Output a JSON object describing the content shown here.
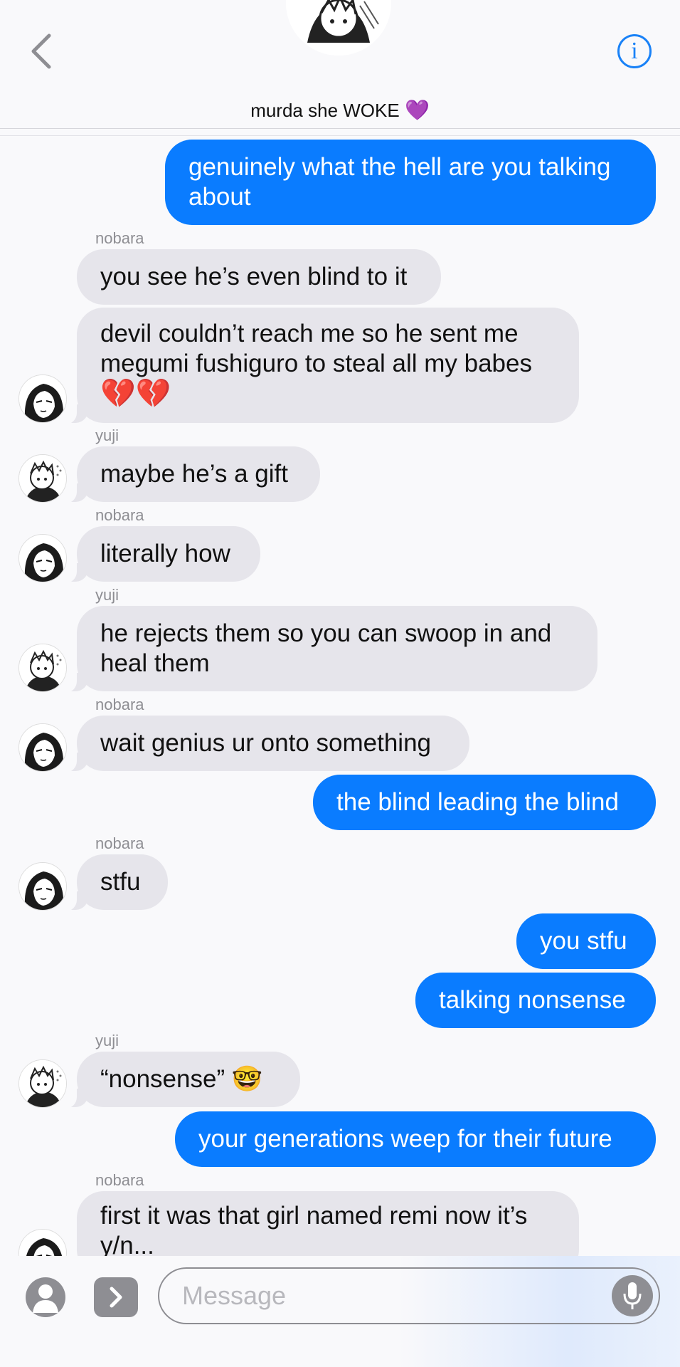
{
  "header": {
    "title": "murda she WOKE",
    "title_emoji": "💜",
    "info_label": "i"
  },
  "messages": [
    {
      "side": "out",
      "text": "genuinely what the hell are you talking\nabout"
    },
    {
      "side": "in",
      "sender": "nobara",
      "text": "you see he’s even blind to it"
    },
    {
      "side": "in",
      "text": "devil couldn’t reach me so he sent me\nmegumi fushiguro to steal all my babes",
      "emoji": "💔💔"
    },
    {
      "side": "in",
      "sender": "yuji",
      "text": "maybe he’s a gift"
    },
    {
      "side": "in",
      "sender": "nobara",
      "text": "literally how"
    },
    {
      "side": "in",
      "sender": "yuji",
      "text": "he rejects them so you can swoop in and\nheal them"
    },
    {
      "side": "in",
      "sender": "nobara",
      "text": "wait genius ur onto something"
    },
    {
      "side": "out",
      "text": "the blind leading the blind"
    },
    {
      "side": "in",
      "sender": "nobara",
      "text": "stfu"
    },
    {
      "side": "out",
      "text": "you stfu"
    },
    {
      "side": "out",
      "text": "talking nonsense"
    },
    {
      "side": "in",
      "sender": "yuji",
      "text": "“nonsense” 🤓"
    },
    {
      "side": "out",
      "text": "your generations weep for their future"
    },
    {
      "side": "in",
      "sender": "nobara",
      "text": "first it was that girl named remi now it’s\ny/n..."
    }
  ],
  "input": {
    "placeholder": "Message"
  }
}
